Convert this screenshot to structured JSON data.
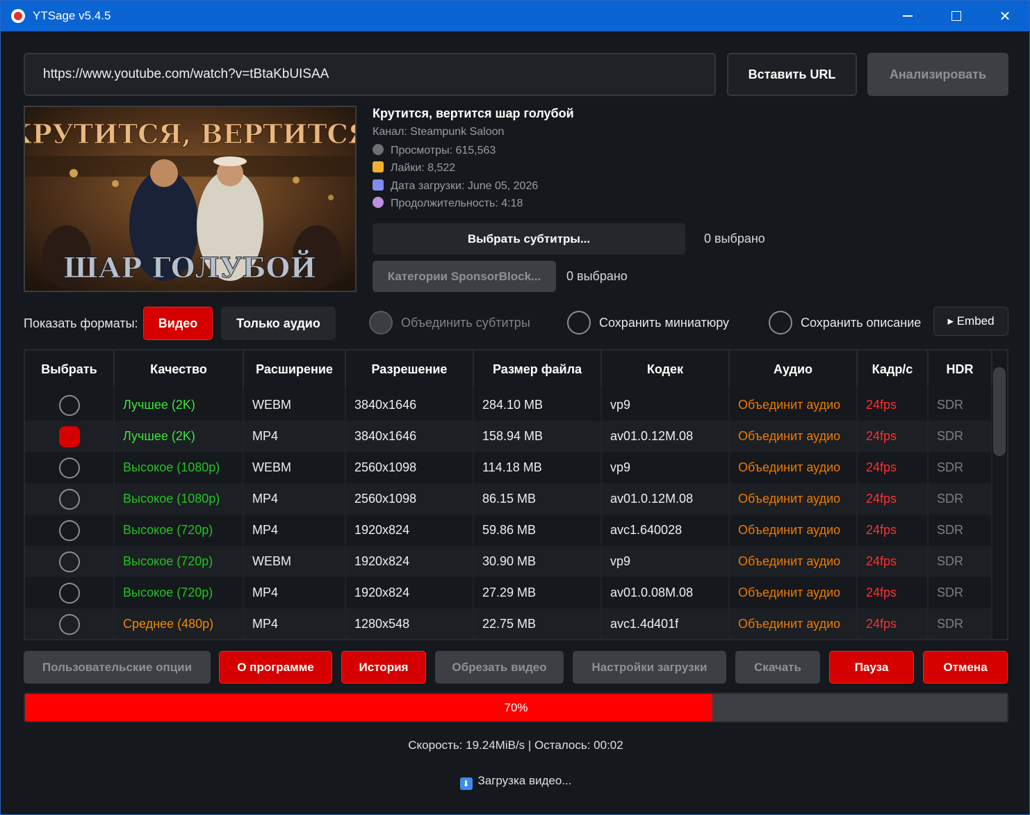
{
  "window": {
    "title": "YTSage  v5.4.5"
  },
  "url_bar": {
    "value": "https://www.youtube.com/watch?v=tBtaKbUISAA",
    "paste_label": "Вставить URL",
    "analyze_label": "Анализировать"
  },
  "thumbnail": {
    "text_top": "КРУТИТСЯ, ВЕРТИТСЯ",
    "text_bottom": "ШАР ГОЛУБОЙ"
  },
  "video": {
    "title": "Крутится, вертится шар голубой",
    "channel": "Канал: Steampunk Saloon",
    "views": "Просмотры: 615,563",
    "likes": "Лайки: 8,522",
    "upload_date": "Дата загрузки: June 05, 2026",
    "duration": "Продолжительность: 4:18"
  },
  "subtitles": {
    "button_label": "Выбрать субтитры...",
    "count": "0 выбрано"
  },
  "sponsorblock": {
    "button_label": "Категории SponsorBlock...",
    "count": "0 выбрано"
  },
  "formats": {
    "label": "Показать форматы:",
    "video_label": "Видео",
    "audio_label": "Только аудио",
    "merge_subs_label": "Объединить субтитры",
    "save_thumb_label": "Сохранить миниатюру",
    "save_desc_label": "Сохранить описание",
    "embed_label": "▸ Embed"
  },
  "colors": {
    "accent_red": "#d60000",
    "quality_best": "#3ee63e",
    "quality_high": "#22c422",
    "quality_medium": "#f08a00",
    "audio_merge": "#f07a00",
    "fps": "#ff3030",
    "hdr": "#7c8086"
  },
  "table": {
    "headers": [
      "Выбрать",
      "Качество",
      "Расширение",
      "Разрешение",
      "Размер файла",
      "Кодек",
      "Аудио",
      "Кадр/с",
      "HDR"
    ],
    "rows": [
      {
        "selected": false,
        "quality": "Лучшее (2K)",
        "tier": "best",
        "ext": "WEBM",
        "res": "3840x1646",
        "size": "284.10 MB",
        "codec": "vp9",
        "audio": "Объединит аудио",
        "fps": "24fps",
        "hdr": "SDR"
      },
      {
        "selected": true,
        "quality": "Лучшее (2K)",
        "tier": "best",
        "ext": "MP4",
        "res": "3840x1646",
        "size": "158.94 MB",
        "codec": "av01.0.12M.08",
        "audio": "Объединит аудио",
        "fps": "24fps",
        "hdr": "SDR"
      },
      {
        "selected": false,
        "quality": "Высокое (1080p)",
        "tier": "high",
        "ext": "WEBM",
        "res": "2560x1098",
        "size": "114.18 MB",
        "codec": "vp9",
        "audio": "Объединит аудио",
        "fps": "24fps",
        "hdr": "SDR"
      },
      {
        "selected": false,
        "quality": "Высокое (1080p)",
        "tier": "high",
        "ext": "MP4",
        "res": "2560x1098",
        "size": "86.15 MB",
        "codec": "av01.0.12M.08",
        "audio": "Объединит аудио",
        "fps": "24fps",
        "hdr": "SDR"
      },
      {
        "selected": false,
        "quality": "Высокое (720p)",
        "tier": "high",
        "ext": "MP4",
        "res": "1920x824",
        "size": "59.86 MB",
        "codec": "avc1.640028",
        "audio": "Объединит аудио",
        "fps": "24fps",
        "hdr": "SDR"
      },
      {
        "selected": false,
        "quality": "Высокое (720p)",
        "tier": "high",
        "ext": "WEBM",
        "res": "1920x824",
        "size": "30.90 MB",
        "codec": "vp9",
        "audio": "Объединит аудио",
        "fps": "24fps",
        "hdr": "SDR"
      },
      {
        "selected": false,
        "quality": "Высокое (720p)",
        "tier": "high",
        "ext": "MP4",
        "res": "1920x824",
        "size": "27.29 MB",
        "codec": "av01.0.08M.08",
        "audio": "Объединит аудио",
        "fps": "24fps",
        "hdr": "SDR"
      },
      {
        "selected": false,
        "quality": "Среднее (480p)",
        "tier": "medium",
        "ext": "MP4",
        "res": "1280x548",
        "size": "22.75 MB",
        "codec": "avc1.4d401f",
        "audio": "Объединит аудио",
        "fps": "24fps",
        "hdr": "SDR"
      }
    ]
  },
  "actions": {
    "custom_options": "Пользовательские опции",
    "about": "О программе",
    "history": "История",
    "trim": "Обрезать видео",
    "download_settings": "Настройки загрузки",
    "download": "Скачать",
    "pause": "Пауза",
    "cancel": "Отмена"
  },
  "progress": {
    "percent": 70,
    "label": "70%"
  },
  "status": {
    "speed": "Скорость: 19.24MiB/s | Осталось: 00:02",
    "message": "Загрузка видео..."
  }
}
